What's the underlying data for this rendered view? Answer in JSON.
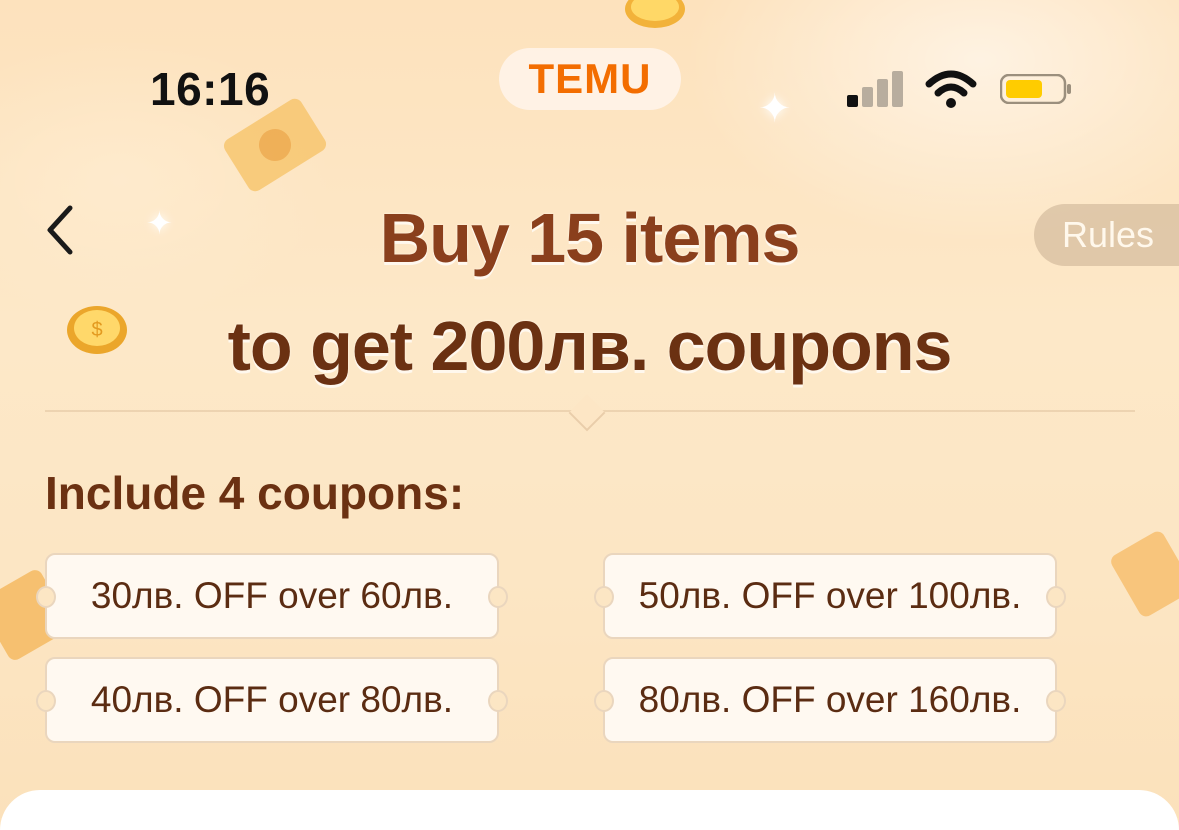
{
  "status_bar": {
    "time": "16:16",
    "brand": "TEMU",
    "icons": [
      "signal-icon",
      "wifi-icon",
      "battery-icon"
    ]
  },
  "header": {
    "back_icon": "chevron-left-icon",
    "title_line1": "Buy 15 items",
    "title_line2": "to get 200лв. coupons",
    "rules_label": "Rules"
  },
  "coupons": {
    "label": "Include 4 coupons:",
    "items": [
      "30лв. OFF over 60лв.",
      "50лв. OFF over 100лв.",
      "40лв. OFF over 80лв.",
      "80лв. OFF over 160лв."
    ]
  },
  "colors": {
    "brand": "#f36d00",
    "title": "#8a3f1c",
    "background": "#fde2bd",
    "coupon_bg": "#fff9f1"
  }
}
